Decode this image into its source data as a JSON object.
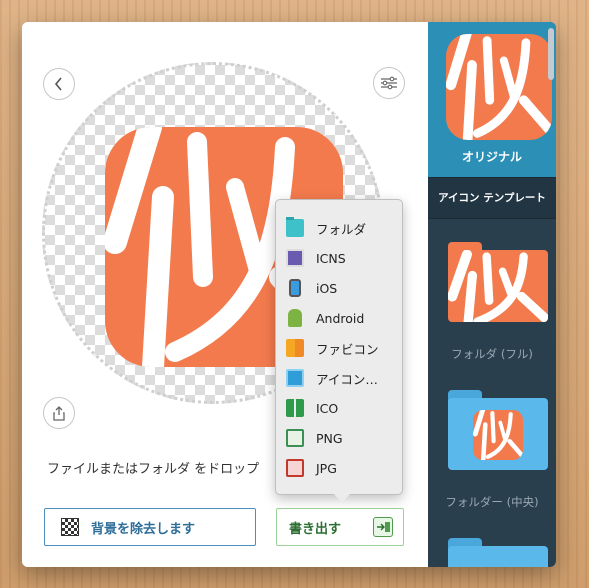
{
  "nav": {
    "back_icon": "chevron-left-icon",
    "settings_icon": "sliders-icon",
    "share_icon": "share-icon"
  },
  "preview": {
    "glyph": "似"
  },
  "hint": "ファイルまたはフォルダ をドロップ",
  "buttons": {
    "remove_bg": "背景を除去します",
    "export": "書き出す"
  },
  "export_menu": [
    {
      "label": "フォルダ",
      "icon": "folder-icon"
    },
    {
      "label": "ICNS",
      "icon": "icns-icon"
    },
    {
      "label": "iOS",
      "icon": "iphone-icon"
    },
    {
      "label": "Android",
      "icon": "android-icon"
    },
    {
      "label": "ファビコン",
      "icon": "favicon-icon"
    },
    {
      "label": "アイコン…",
      "icon": "icon-folder-icon"
    },
    {
      "label": "ICO",
      "icon": "windows-icon"
    },
    {
      "label": "PNG",
      "icon": "png-icon"
    },
    {
      "label": "JPG",
      "icon": "jpg-icon"
    }
  ],
  "sidebar": {
    "original_label": "オリジナル",
    "templates_header": "アイコン テンプレート",
    "templates": [
      {
        "label": "フォルダ (フル)"
      },
      {
        "label": "フォルダー (中央)"
      }
    ]
  },
  "colors": {
    "accent": "#f37a4d",
    "sidebar_bg": "#2a3f4e",
    "sidebar_selected": "#2b8fb6",
    "folder_blue": "#5ab8ea"
  }
}
